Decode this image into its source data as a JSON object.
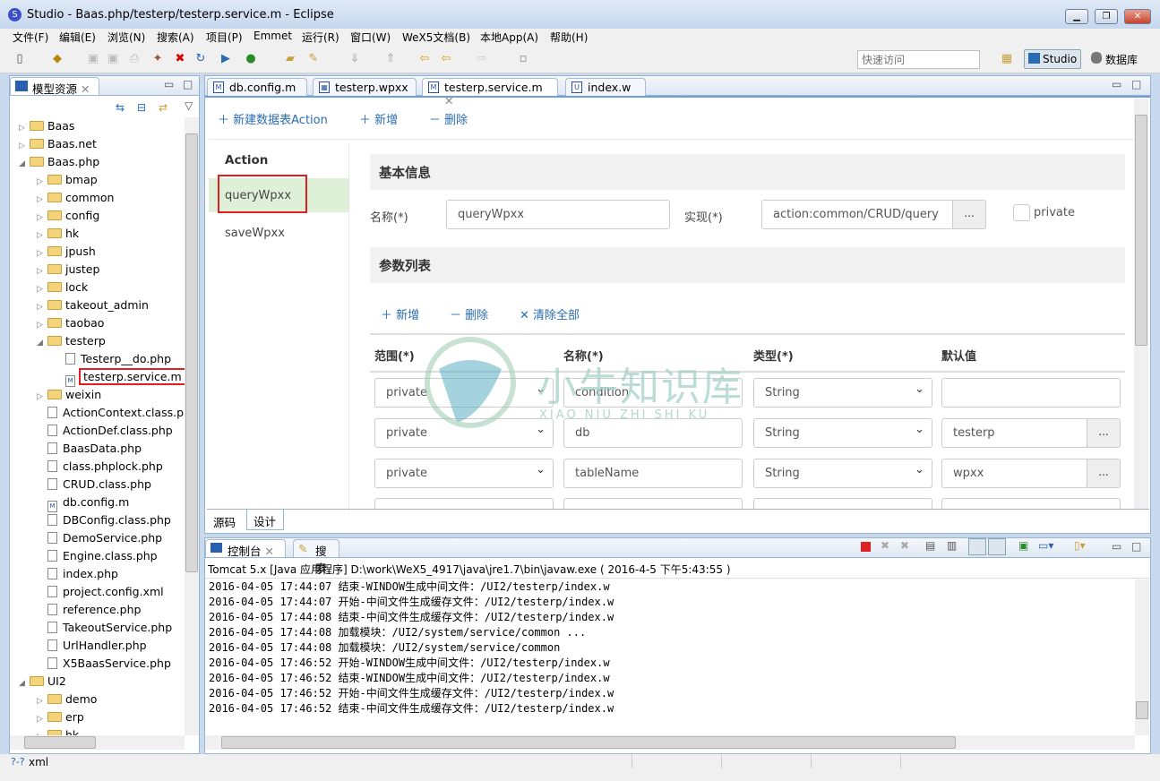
{
  "window": {
    "title": "Studio - Baas.php/testerp/testerp.service.m - Eclipse",
    "logo": "S"
  },
  "menu": [
    "文件(F)",
    "编辑(E)",
    "浏览(N)",
    "搜索(A)",
    "项目(P)",
    "Emmet",
    "运行(R)",
    "窗口(W)",
    "WeX5文档(B)",
    "本地App(A)",
    "帮助(H)"
  ],
  "toolbar": {
    "quick_access_placeholder": "快速访问",
    "perspectives": [
      "Studio",
      "数据库"
    ]
  },
  "explorer": {
    "title": "模型资源",
    "tree": [
      {
        "label": "Baas",
        "level": 0,
        "type": "folder",
        "exp": "▷"
      },
      {
        "label": "Baas.net",
        "level": 0,
        "type": "folder",
        "exp": "▷"
      },
      {
        "label": "Baas.php",
        "level": 0,
        "type": "folder",
        "exp": "◢"
      },
      {
        "label": "bmap",
        "level": 1,
        "type": "folder",
        "exp": "▷"
      },
      {
        "label": "common",
        "level": 1,
        "type": "folder",
        "exp": "▷"
      },
      {
        "label": "config",
        "level": 1,
        "type": "folder",
        "exp": "▷"
      },
      {
        "label": "hk",
        "level": 1,
        "type": "folder",
        "exp": "▷"
      },
      {
        "label": "jpush",
        "level": 1,
        "type": "folder",
        "exp": "▷"
      },
      {
        "label": "justep",
        "level": 1,
        "type": "folder",
        "exp": "▷"
      },
      {
        "label": "lock",
        "level": 1,
        "type": "folder",
        "exp": "▷"
      },
      {
        "label": "takeout_admin",
        "level": 1,
        "type": "folder",
        "exp": "▷"
      },
      {
        "label": "taobao",
        "level": 1,
        "type": "folder",
        "exp": "▷"
      },
      {
        "label": "testerp",
        "level": 1,
        "type": "folder",
        "exp": "◢"
      },
      {
        "label": "Testerp__do.php",
        "level": 2,
        "type": "file",
        "exp": ""
      },
      {
        "label": "testerp.service.m",
        "level": 2,
        "type": "m",
        "exp": "",
        "highlight": true
      },
      {
        "label": "weixin",
        "level": 1,
        "type": "folder",
        "exp": "▷"
      },
      {
        "label": "ActionContext.class.php",
        "level": 1,
        "type": "file",
        "exp": ""
      },
      {
        "label": "ActionDef.class.php",
        "level": 1,
        "type": "file",
        "exp": ""
      },
      {
        "label": "BaasData.php",
        "level": 1,
        "type": "file",
        "exp": ""
      },
      {
        "label": "class.phplock.php",
        "level": 1,
        "type": "file",
        "exp": ""
      },
      {
        "label": "CRUD.class.php",
        "level": 1,
        "type": "file",
        "exp": ""
      },
      {
        "label": "db.config.m",
        "level": 1,
        "type": "m",
        "exp": ""
      },
      {
        "label": "DBConfig.class.php",
        "level": 1,
        "type": "file",
        "exp": ""
      },
      {
        "label": "DemoService.php",
        "level": 1,
        "type": "file",
        "exp": ""
      },
      {
        "label": "Engine.class.php",
        "level": 1,
        "type": "file",
        "exp": ""
      },
      {
        "label": "index.php",
        "level": 1,
        "type": "file",
        "exp": ""
      },
      {
        "label": "project.config.xml",
        "level": 1,
        "type": "file",
        "exp": ""
      },
      {
        "label": "reference.php",
        "level": 1,
        "type": "file",
        "exp": ""
      },
      {
        "label": "TakeoutService.php",
        "level": 1,
        "type": "file",
        "exp": ""
      },
      {
        "label": "UrlHandler.php",
        "level": 1,
        "type": "file",
        "exp": ""
      },
      {
        "label": "X5BaasService.php",
        "level": 1,
        "type": "file",
        "exp": ""
      },
      {
        "label": "UI2",
        "level": 0,
        "type": "folder",
        "exp": "◢"
      },
      {
        "label": "demo",
        "level": 1,
        "type": "folder",
        "exp": "▷"
      },
      {
        "label": "erp",
        "level": 1,
        "type": "folder",
        "exp": "▷"
      },
      {
        "label": "hk",
        "level": 1,
        "type": "folder",
        "exp": "▷"
      }
    ]
  },
  "editor": {
    "tabs": [
      {
        "label": "db.config.m",
        "icon": "M"
      },
      {
        "label": "testerp.wpxx",
        "icon": "grid"
      },
      {
        "label": "testerp.service.m",
        "icon": "M",
        "active": true
      },
      {
        "label": "index.w",
        "icon": "U"
      }
    ],
    "actions": {
      "new_table_action": "新建数据表Action",
      "add": "新增",
      "delete": "删除"
    },
    "action_list": {
      "header": "Action",
      "items": [
        "queryWpxx",
        "saveWpxx"
      ],
      "selected": "queryWpxx"
    },
    "basic": {
      "title": "基本信息",
      "name_label": "名称(*)",
      "name_value": "queryWpxx",
      "impl_label": "实现(*)",
      "impl_value": "action:common/CRUD/query",
      "browse": "...",
      "private_label": "private"
    },
    "params": {
      "title": "参数列表",
      "add": "新增",
      "delete": "删除",
      "clear": "清除全部",
      "columns": [
        "范围(*)",
        "名称(*)",
        "类型(*)",
        "默认值"
      ],
      "rows": [
        {
          "scope": "private",
          "name": "condition",
          "type": "String",
          "default": ""
        },
        {
          "scope": "private",
          "name": "db",
          "type": "String",
          "default": "testerp"
        },
        {
          "scope": "private",
          "name": "tableName",
          "type": "String",
          "default": "wpxx"
        }
      ]
    },
    "bottom_tabs": [
      "源码",
      "设计"
    ]
  },
  "console": {
    "tabs": [
      "控制台",
      "搜索"
    ],
    "process": "Tomcat 5.x [Java 应用程序] D:\\work\\WeX5_4917\\java\\jre1.7\\bin\\javaw.exe ( 2016-4-5 下午5:43:55 )",
    "lines": [
      "2016-04-05 17:44:07 结束-WINDOW生成中间文件：/UI2/testerp/index.w",
      "2016-04-05 17:44:07 开始-中间文件生成缓存文件：/UI2/testerp/index.w",
      "2016-04-05 17:44:08 结束-中间文件生成缓存文件：/UI2/testerp/index.w",
      "2016-04-05 17:44:08 加载模块：/UI2/system/service/common ...",
      "2016-04-05 17:44:08 加载模块：/UI2/system/service/common",
      "2016-04-05 17:46:52 开始-WINDOW生成中间文件：/UI2/testerp/index.w",
      "2016-04-05 17:46:52 结束-WINDOW生成中间文件：/UI2/testerp/index.w",
      "2016-04-05 17:46:52 开始-中间文件生成缓存文件：/UI2/testerp/index.w",
      "2016-04-05 17:46:52 结束-中间文件生成缓存文件：/UI2/testerp/index.w"
    ]
  },
  "status": {
    "text": "xml"
  },
  "watermark": {
    "cn": "小牛知识库",
    "en": "XIAO NIU ZHI SHI KU"
  },
  "colors": {
    "link": "#2a6cb3",
    "selected_row": "#dff0d8",
    "highlight_box": "#e02020"
  }
}
